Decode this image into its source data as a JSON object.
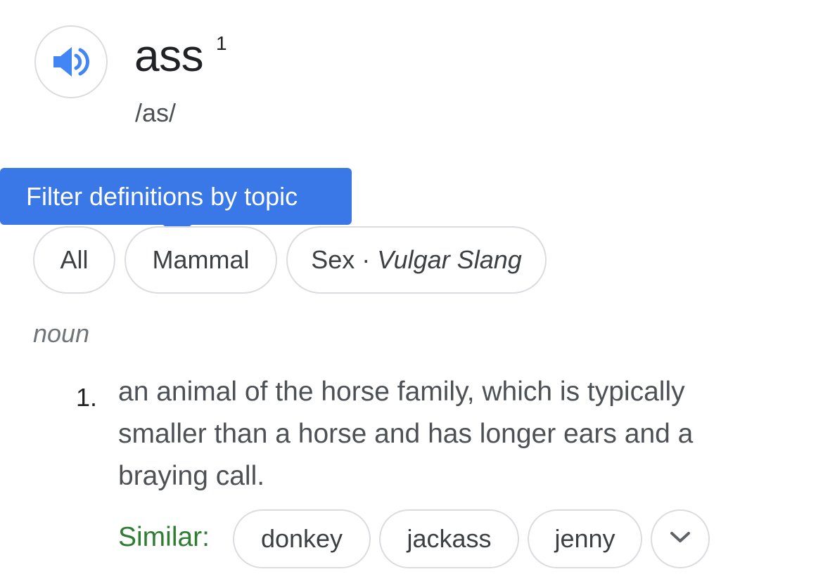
{
  "entry": {
    "headword": "ass",
    "homograph_number": "1",
    "phonetic": "/as/",
    "speaker_icon": "speaker-icon"
  },
  "tooltip": {
    "text": "Filter definitions by topic"
  },
  "topics": {
    "all": "All",
    "mammal": "Mammal",
    "sex": "Sex",
    "separator": " · ",
    "sex_register": "Vulgar Slang"
  },
  "part_of_speech": "noun",
  "sense": {
    "number": "1.",
    "definition": "an animal of the horse family, which is typically smaller than a horse and has longer ears and a braying call."
  },
  "similar": {
    "label": "Similar:",
    "items": [
      "donkey",
      "jackass",
      "jenny"
    ],
    "expand_icon": "chevron-down-icon"
  },
  "colors": {
    "accent_blue": "#3b78e7",
    "speaker_blue": "#4285f4",
    "similar_green": "#2e7d32",
    "chip_border": "#dadce0"
  }
}
